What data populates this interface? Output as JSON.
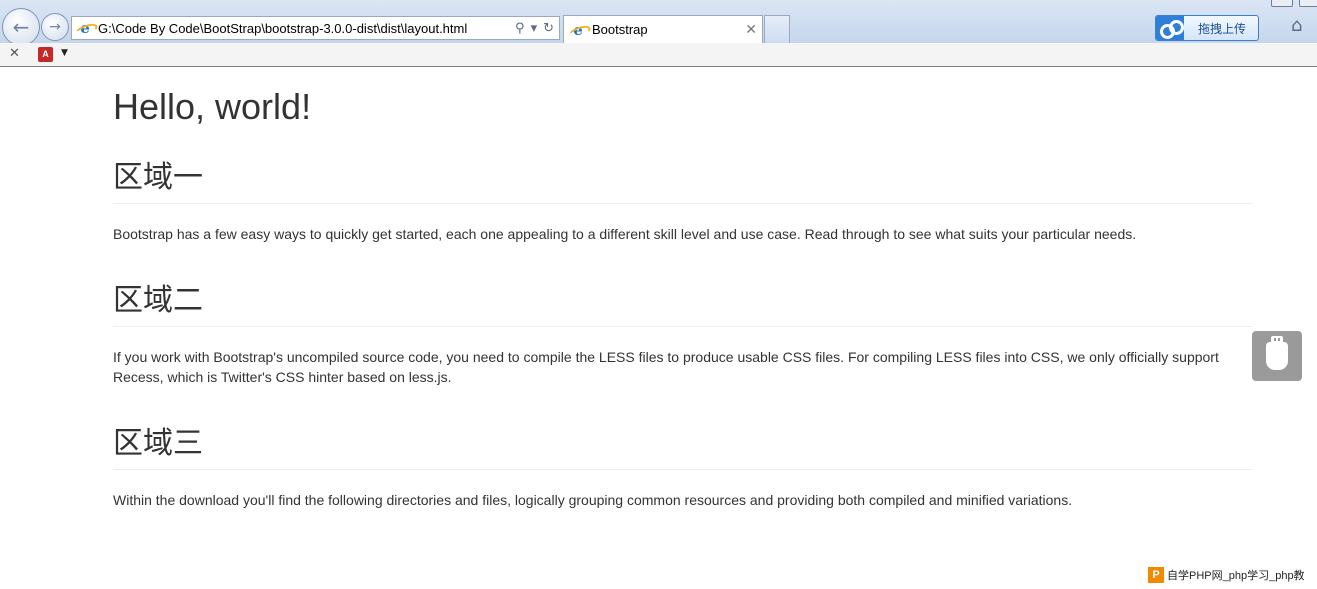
{
  "browser": {
    "address_url": "G:\\Code By Code\\BootStrap\\bootstrap-3.0.0-dist\\dist\\layout.html",
    "tab_title": "Bootstrap",
    "upload_label": "拖拽上传",
    "icons": {
      "back": "back-arrow-icon",
      "forward": "forward-arrow-icon",
      "search": "search-icon",
      "refresh": "refresh-icon",
      "home": "home-icon"
    }
  },
  "page": {
    "title": "Hello, world!",
    "sections": [
      {
        "heading": "区域一",
        "text": "Bootstrap has a few easy ways to quickly get started, each one appealing to a different skill level and use case. Read through to see what suits your particular needs."
      },
      {
        "heading": "区域二",
        "text": "If you work with Bootstrap's uncompiled source code, you need to compile the LESS files to produce usable CSS files. For compiling LESS files into CSS, we only officially support Recess, which is Twitter's CSS hinter based on less.js."
      },
      {
        "heading": "区域三",
        "text": "Within the download you'll find the following directories and files, logically grouping common resources and providing both compiled and minified variations."
      }
    ]
  },
  "watermark": {
    "logo": "P",
    "text": "自学PHP网_php学习_php教"
  }
}
